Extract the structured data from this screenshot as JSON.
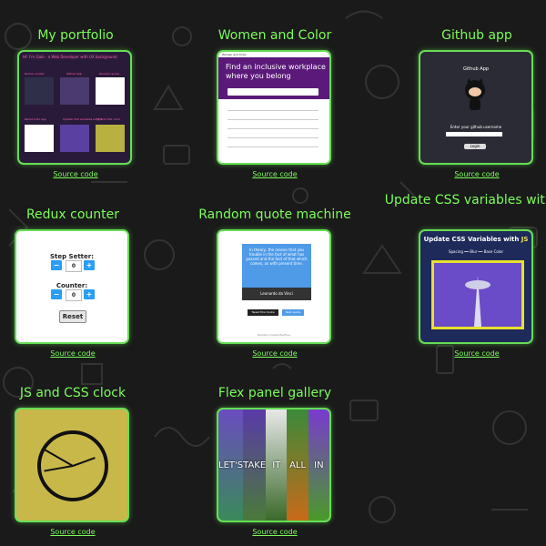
{
  "colors": {
    "accent": "#7CFC5A",
    "frame_border": "#66dd55",
    "background": "#1a1a1a"
  },
  "projects": [
    {
      "title": "My portfolio",
      "source": "Source code"
    },
    {
      "title": "Women and Color",
      "source": "Source code"
    },
    {
      "title": "Github app",
      "source": "Source code"
    },
    {
      "title": "Redux counter",
      "source": "Source code"
    },
    {
      "title": "Random quote machine",
      "source": "Source code"
    },
    {
      "title": "Update CSS variables with JS",
      "source": "Source code"
    },
    {
      "title": "JS and CSS clock",
      "source": "Source code"
    },
    {
      "title": "Flex panel gallery",
      "source": "Source code"
    }
  ],
  "portfolio": {
    "header": "Hi! I'm Gabi - a Web Developer with UX background",
    "labels": [
      "Redux counter",
      "Github app",
      "Random quote",
      "Redux todo app",
      "Update CSS variables with JS",
      "JS and CSS clock"
    ]
  },
  "women_color": {
    "title": "Women and Color",
    "hero": "Find an inclusive workplace where you belong"
  },
  "github": {
    "title": "Github App",
    "prompt": "Enter your github username",
    "button": "Login"
  },
  "redux": {
    "step_label": "Step Setter:",
    "step_value": "0",
    "counter_label": "Counter:",
    "counter_value": "0",
    "minus": "−",
    "plus": "+",
    "reset": "Reset"
  },
  "quote": {
    "text": "In theory, the reason that you trouble in the fact of what has passed and the fact of that which comes, as with present time.",
    "author": "Leonardo da Vinci",
    "tweet": "Tweet this Quote",
    "next": "Next quote",
    "footer": "Random Quote Machine"
  },
  "css_vars": {
    "title_prefix": "Update CSS Variables with ",
    "title_js": "JS",
    "controls": "Spacing ━━  Blur ━━  Base Color"
  },
  "flex": {
    "panels": [
      "LET'S",
      "TAKE",
      "IT",
      "ALL",
      "IN"
    ]
  }
}
